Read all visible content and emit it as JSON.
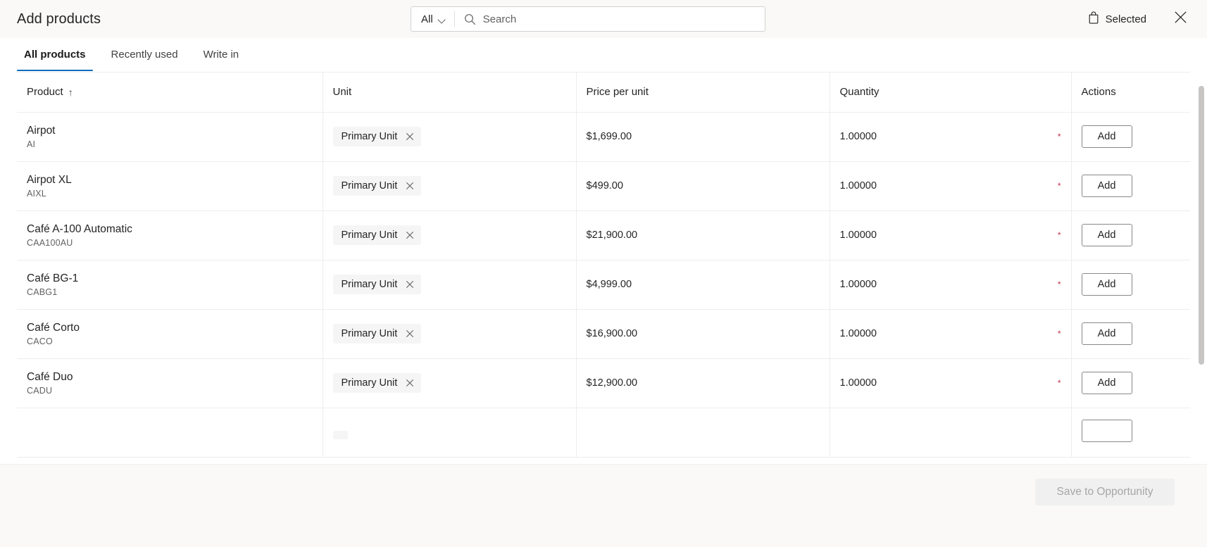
{
  "header": {
    "title": "Add products",
    "search": {
      "filter_label": "All",
      "filter_icon": "chevron-down-icon",
      "icon": "search-icon",
      "placeholder": "Search",
      "value": ""
    },
    "selected": {
      "label": "Selected",
      "icon": "shopping-bag-icon"
    },
    "close": {
      "icon": "close-icon",
      "label": "Close"
    }
  },
  "tabs": [
    {
      "label": "All products",
      "active": true
    },
    {
      "label": "Recently used",
      "active": false
    },
    {
      "label": "Write in",
      "active": false
    }
  ],
  "table": {
    "columns": [
      {
        "label": "Product",
        "sort_indicator": "↑"
      },
      {
        "label": "Unit",
        "sort_indicator": ""
      },
      {
        "label": "Price per unit",
        "sort_indicator": ""
      },
      {
        "label": "Quantity",
        "sort_indicator": ""
      },
      {
        "label": "Actions",
        "sort_indicator": ""
      }
    ],
    "rows": [
      {
        "product_name": "Airpot",
        "product_code": "AI",
        "unit": "Primary Unit",
        "unit_remove_icon": "close-icon",
        "price": "$1,699.00",
        "quantity": "1.00000",
        "required_marker": "*",
        "action_label": "Add"
      },
      {
        "product_name": "Airpot XL",
        "product_code": "AIXL",
        "unit": "Primary Unit",
        "unit_remove_icon": "close-icon",
        "price": "$499.00",
        "quantity": "1.00000",
        "required_marker": "*",
        "action_label": "Add"
      },
      {
        "product_name": "Café A-100 Automatic",
        "product_code": "CAA100AU",
        "unit": "Primary Unit",
        "unit_remove_icon": "close-icon",
        "price": "$21,900.00",
        "quantity": "1.00000",
        "required_marker": "*",
        "action_label": "Add"
      },
      {
        "product_name": "Café BG-1",
        "product_code": "CABG1",
        "unit": "Primary Unit",
        "unit_remove_icon": "close-icon",
        "price": "$4,999.00",
        "quantity": "1.00000",
        "required_marker": "*",
        "action_label": "Add"
      },
      {
        "product_name": "Café Corto",
        "product_code": "CACO",
        "unit": "Primary Unit",
        "unit_remove_icon": "close-icon",
        "price": "$16,900.00",
        "quantity": "1.00000",
        "required_marker": "*",
        "action_label": "Add"
      },
      {
        "product_name": "Café Duo",
        "product_code": "CADU",
        "unit": "Primary Unit",
        "unit_remove_icon": "close-icon",
        "price": "$12,900.00",
        "quantity": "1.00000",
        "required_marker": "*",
        "action_label": "Add"
      },
      {
        "product_name": "",
        "product_code": "",
        "unit": "",
        "unit_remove_icon": "close-icon",
        "price": "",
        "quantity": "",
        "required_marker": "",
        "action_label": ""
      }
    ]
  },
  "footer": {
    "save_label": "Save to Opportunity",
    "save_disabled": true
  },
  "colors": {
    "accent": "#0f6cbd",
    "header_bg": "#faf9f8",
    "required": "#c4314b",
    "border": "#ededed",
    "pill_bg": "#f5f5f5",
    "scrollbar": "#c8c6c4",
    "disabled_text": "#a6a6a6"
  }
}
